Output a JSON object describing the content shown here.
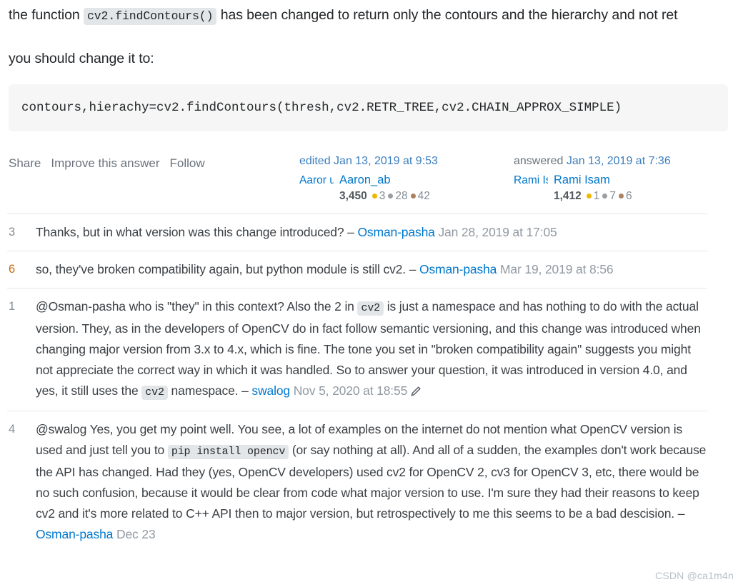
{
  "answer": {
    "paragraph_1_before": "the function ",
    "paragraph_1_code": "cv2.findContours()",
    "paragraph_1_after": " has been changed to return only the contours and the hierarchy and not ret",
    "paragraph_2": "you should change it to:",
    "code_block": "contours,hierachy=cv2.findContours(thresh,cv2.RETR_TREE,cv2.CHAIN_APPROX_SIMPLE)"
  },
  "actions": {
    "share": "Share",
    "improve": "Improve this answer",
    "follow": "Follow"
  },
  "editor_card": {
    "stamp": "edited Jan 13, 2019 at 9:53",
    "avatar_alt": "Aaror user",
    "username": "Aaron_ab",
    "reputation": "3,450",
    "gold": "3",
    "silver": "28",
    "bronze": "42"
  },
  "author_card": {
    "stamp_lead": "answered ",
    "stamp": "Jan 13, 2019 at 7:36",
    "avatar_alt": "Rami Isam's",
    "username": "Rami Isam",
    "reputation": "1,412",
    "gold": "1",
    "silver": "7",
    "bronze": "6"
  },
  "comments": [
    {
      "score": "3",
      "hot": false,
      "segments": [
        {
          "t": "text",
          "v": "Thanks, but in what version was this change introduced? "
        },
        {
          "t": "dash",
          "v": "– "
        },
        {
          "t": "user",
          "v": "Osman-pasha"
        },
        {
          "t": "date",
          "v": " Jan 28, 2019 at 17:05"
        }
      ]
    },
    {
      "score": "6",
      "hot": true,
      "segments": [
        {
          "t": "text",
          "v": "so, they've broken compatibility again, but python module is still cv2. "
        },
        {
          "t": "dash",
          "v": "– "
        },
        {
          "t": "user",
          "v": "Osman-pasha"
        },
        {
          "t": "date",
          "v": " Mar 19, 2019 at 8:56"
        }
      ]
    },
    {
      "score": "1",
      "hot": false,
      "segments": [
        {
          "t": "text",
          "v": "@Osman-pasha who is \"they\" in this context? Also the 2 in "
        },
        {
          "t": "code",
          "v": "cv2"
        },
        {
          "t": "text",
          "v": " is just a namespace and has nothing to do with the actual version. They, as in the developers of OpenCV do in fact follow semantic versioning, and this change was introduced when changing major version from 3.x to 4.x, which is fine. The tone you set in \"broken compatibility again\" suggests you might not appreciate the correct way in which it was handled. So to answer your question, it was introduced in version 4.0, and yes, it still uses the "
        },
        {
          "t": "code",
          "v": "cv2"
        },
        {
          "t": "text",
          "v": " namespace. "
        },
        {
          "t": "dash",
          "v": "– "
        },
        {
          "t": "user",
          "v": "swalog"
        },
        {
          "t": "date",
          "v": " Nov 5, 2020 at 18:55"
        },
        {
          "t": "icon",
          "v": "pencil-icon"
        }
      ]
    },
    {
      "score": "4",
      "hot": false,
      "segments": [
        {
          "t": "text",
          "v": "@swalog Yes, you get my point well. You see, a lot of examples on the internet do not mention what OpenCV version is used and just tell you to "
        },
        {
          "t": "code",
          "v": "pip install opencv"
        },
        {
          "t": "text",
          "v": " (or say nothing at all). And all of a sudden, the examples don't work because the API has changed. Had they (yes, OpenCV developers) used cv2 for OpenCV 2, cv3 for OpenCV 3, etc, there would be no such confusion, because it would be clear from code what major version to use. I'm sure they had their reasons to keep cv2 and it's more related to C++ API then to major version, but retrospectively to me this seems to be a bad descision. "
        },
        {
          "t": "dash",
          "v": "– "
        },
        {
          "t": "user",
          "v": "Osman-pasha"
        },
        {
          "t": "date",
          "v": " Dec 23"
        }
      ]
    }
  ],
  "watermark": "CSDN @ca1m4n",
  "colors": {
    "link": "#0077cc",
    "stamp_link": "#3b7ebf",
    "text": "#232629",
    "comment_text": "#3b4045",
    "muted": "#848d95",
    "hot_score": "#c96a10",
    "gold": "#f1b600",
    "silver": "#9a9c9f",
    "bronze": "#ab825f",
    "code_bg": "#e3e6e8",
    "code_block_bg": "#f6f6f6",
    "divider": "#e4e6e8"
  }
}
